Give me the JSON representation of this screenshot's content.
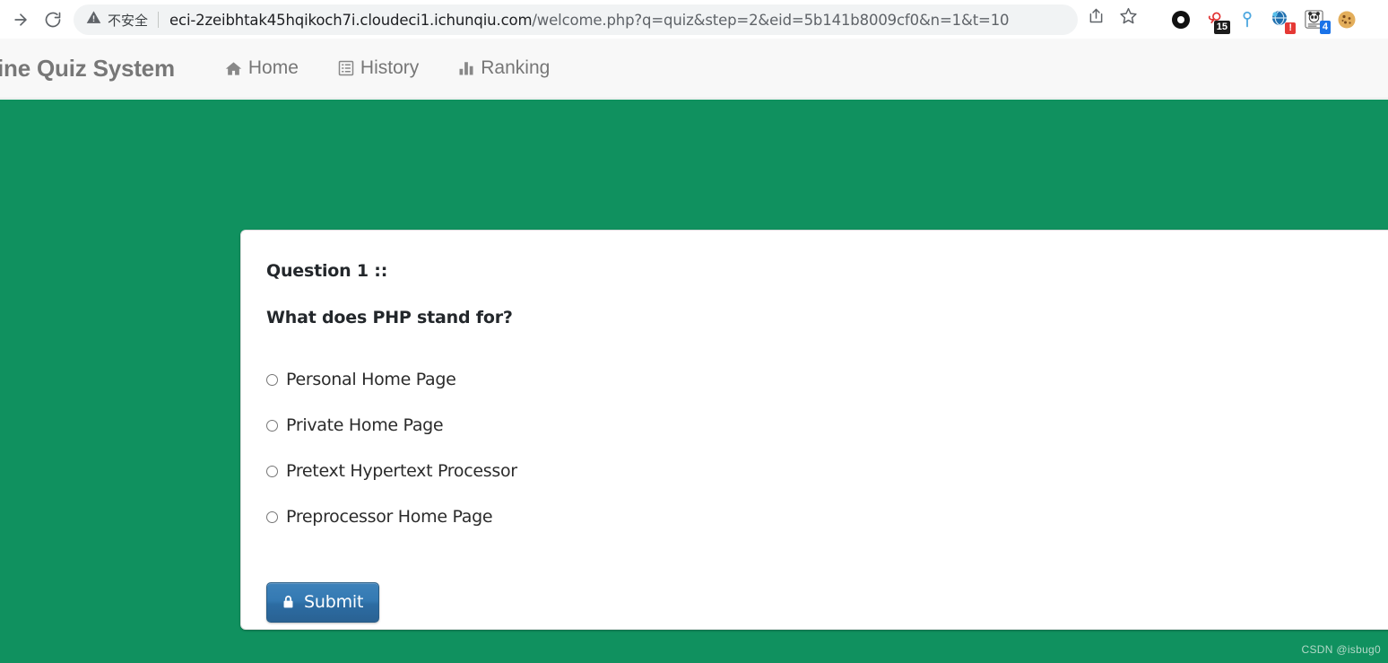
{
  "browser": {
    "back_icon": "arrow-right-icon",
    "reload_icon": "reload-icon",
    "security_warning_icon": "warning-triangle-icon",
    "security_label": "不安全",
    "url_host": "eci-2zeibhtak45hqikoch7i.cloudeci1.ichunqiu.com",
    "url_path": "/welcome.php?q=quiz&step=2&eid=5b141b8009cf0&n=1&t=10",
    "url_full": "eci-2zeibhtak45hqikoch7i.cloudeci1.ichunqiu.com/welcome.php?q=quiz&step=2&eid=5b141b8009cf0&n=1&t=10",
    "share_icon": "share-icon",
    "bookmark_icon": "star-icon",
    "extensions": [
      {
        "name": "black-ring-extension-icon",
        "badge": ""
      },
      {
        "name": "red-loop-extension-icon",
        "badge": "15"
      },
      {
        "name": "blue-pin-extension-icon",
        "badge": ""
      },
      {
        "name": "globe-extension-icon",
        "badge": "!"
      },
      {
        "name": "panda-extension-icon",
        "badge": "4"
      },
      {
        "name": "cookie-extension-icon",
        "badge": ""
      }
    ]
  },
  "site_nav": {
    "brand": "line Quiz System",
    "items": [
      {
        "label": "Home",
        "icon": "home-icon"
      },
      {
        "label": "History",
        "icon": "list-icon"
      },
      {
        "label": "Ranking",
        "icon": "bar-chart-icon"
      }
    ]
  },
  "quiz": {
    "question_number_line": "Question  1 ::",
    "question_text": "What does PHP stand for?",
    "options": [
      {
        "label": "Personal Home Page",
        "checked": false
      },
      {
        "label": "Private Home Page",
        "checked": false
      },
      {
        "label": "Pretext Hypertext Processor",
        "checked": false
      },
      {
        "label": "Preprocessor Home Page",
        "checked": false
      }
    ],
    "submit_label": "Submit",
    "submit_icon": "lock-icon"
  },
  "watermark": "CSDN @isbug0",
  "colors": {
    "page_background": "#10915f",
    "navbar_background": "#f8f8f8",
    "card_background": "#ffffff",
    "submit_button": "#3479b2",
    "nav_text": "#777777"
  }
}
